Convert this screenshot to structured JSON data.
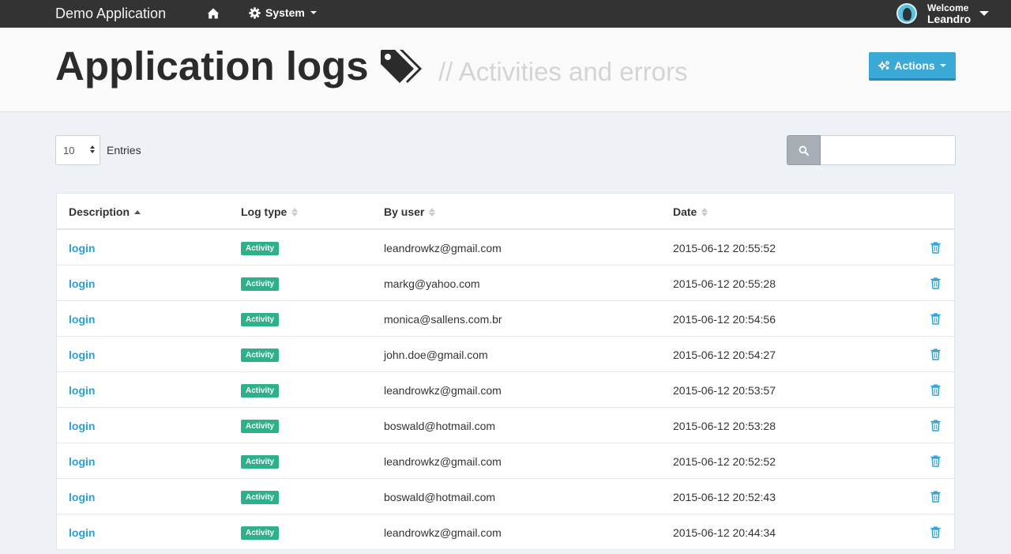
{
  "navbar": {
    "brand": "Demo Application",
    "home_icon": "home-icon",
    "system_label": "System",
    "system_icon": "gear-icon",
    "welcome_label": "Welcome",
    "user_name": "Leandro"
  },
  "header": {
    "title": "Application logs",
    "title_icon": "tags-icon",
    "subtitle": "// Activities and errors",
    "actions_label": "Actions",
    "actions_icon": "cogs-icon"
  },
  "controls": {
    "entries_value": "10",
    "entries_label": "Entries",
    "search_icon": "search-icon",
    "search_value": ""
  },
  "table": {
    "columns": [
      "Description",
      "Log type",
      "By user",
      "Date"
    ],
    "rows": [
      {
        "description": "login",
        "log_type": "Activity",
        "user": "leandrowkz@gmail.com",
        "date": "2015-06-12 20:55:52"
      },
      {
        "description": "login",
        "log_type": "Activity",
        "user": "markg@yahoo.com",
        "date": "2015-06-12 20:55:28"
      },
      {
        "description": "login",
        "log_type": "Activity",
        "user": "monica@sallens.com.br",
        "date": "2015-06-12 20:54:56"
      },
      {
        "description": "login",
        "log_type": "Activity",
        "user": "john.doe@gmail.com",
        "date": "2015-06-12 20:54:27"
      },
      {
        "description": "login",
        "log_type": "Activity",
        "user": "leandrowkz@gmail.com",
        "date": "2015-06-12 20:53:57"
      },
      {
        "description": "login",
        "log_type": "Activity",
        "user": "boswald@hotmail.com",
        "date": "2015-06-12 20:53:28"
      },
      {
        "description": "login",
        "log_type": "Activity",
        "user": "leandrowkz@gmail.com",
        "date": "2015-06-12 20:52:52"
      },
      {
        "description": "login",
        "log_type": "Activity",
        "user": "boswald@hotmail.com",
        "date": "2015-06-12 20:52:43"
      },
      {
        "description": "login",
        "log_type": "Activity",
        "user": "leandrowkz@gmail.com",
        "date": "2015-06-12 20:44:34"
      }
    ],
    "row_action_icon": "trash-icon"
  },
  "colors": {
    "navbar": "#333333",
    "accent": "#2a9fd6",
    "actions_button": "#3aa9d6",
    "activity_badge": "#2eb08a"
  }
}
